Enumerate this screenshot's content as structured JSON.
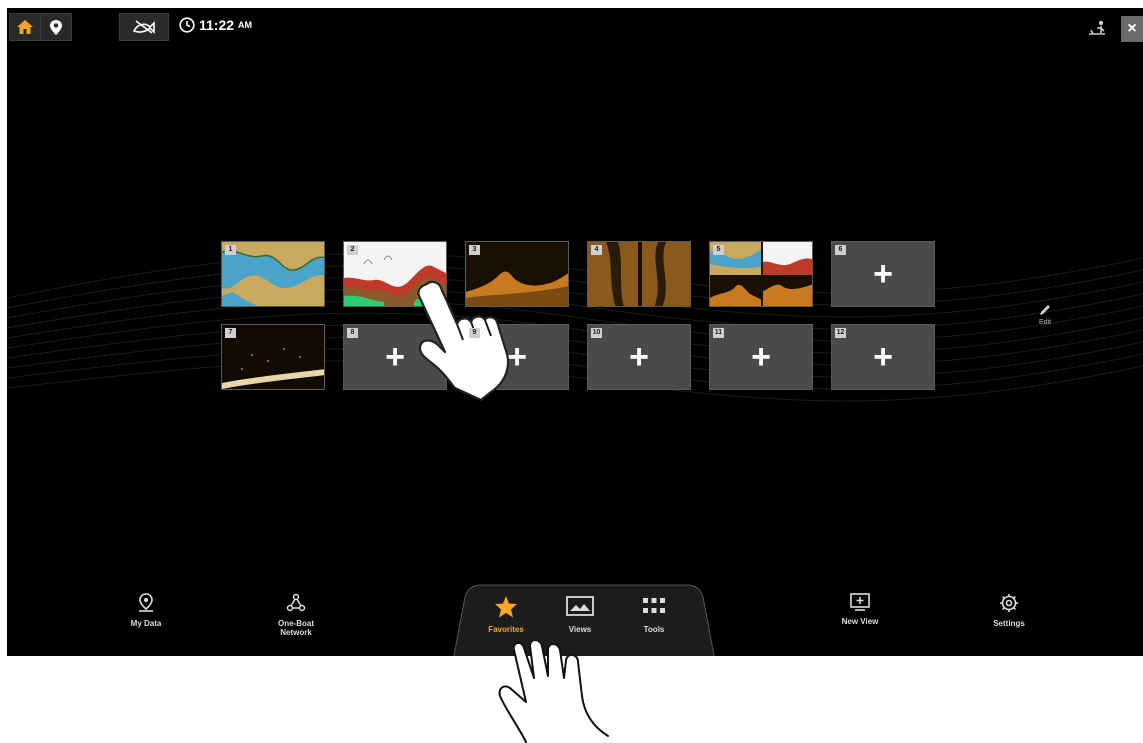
{
  "status_bar": {
    "time": "11:22",
    "ampm": "AM",
    "buttons": [
      {
        "icon": "home-icon"
      },
      {
        "icon": "location-pin-icon"
      },
      {
        "icon": "fish-icon"
      }
    ],
    "close_label": "×"
  },
  "tiles": [
    {
      "num": "1",
      "kind": "chart"
    },
    {
      "num": "2",
      "kind": "sonar"
    },
    {
      "num": "3",
      "kind": "down-imaging"
    },
    {
      "num": "4",
      "kind": "side-imaging"
    },
    {
      "num": "5",
      "kind": "combo"
    },
    {
      "num": "6",
      "kind": "empty",
      "label": "+"
    },
    {
      "num": "7",
      "kind": "360-imaging"
    },
    {
      "num": "8",
      "kind": "empty",
      "label": "+"
    },
    {
      "num": "9",
      "kind": "empty",
      "label": "+"
    },
    {
      "num": "10",
      "kind": "empty",
      "label": "+"
    },
    {
      "num": "11",
      "kind": "empty",
      "label": "+"
    },
    {
      "num": "12",
      "kind": "empty",
      "label": "+"
    }
  ],
  "edit_label": "Edit",
  "bottom_nav": {
    "my_data": "My Data",
    "one_boat_network_1": "One-Boat",
    "one_boat_network_2": "Network",
    "favorites": "Favorites",
    "views": "Views",
    "tools": "Tools",
    "new_view": "New View",
    "settings": "Settings"
  },
  "colors": {
    "accent": "#f5a623",
    "screen_bg": "#000000",
    "tile_bg": "#4a4a4a"
  }
}
